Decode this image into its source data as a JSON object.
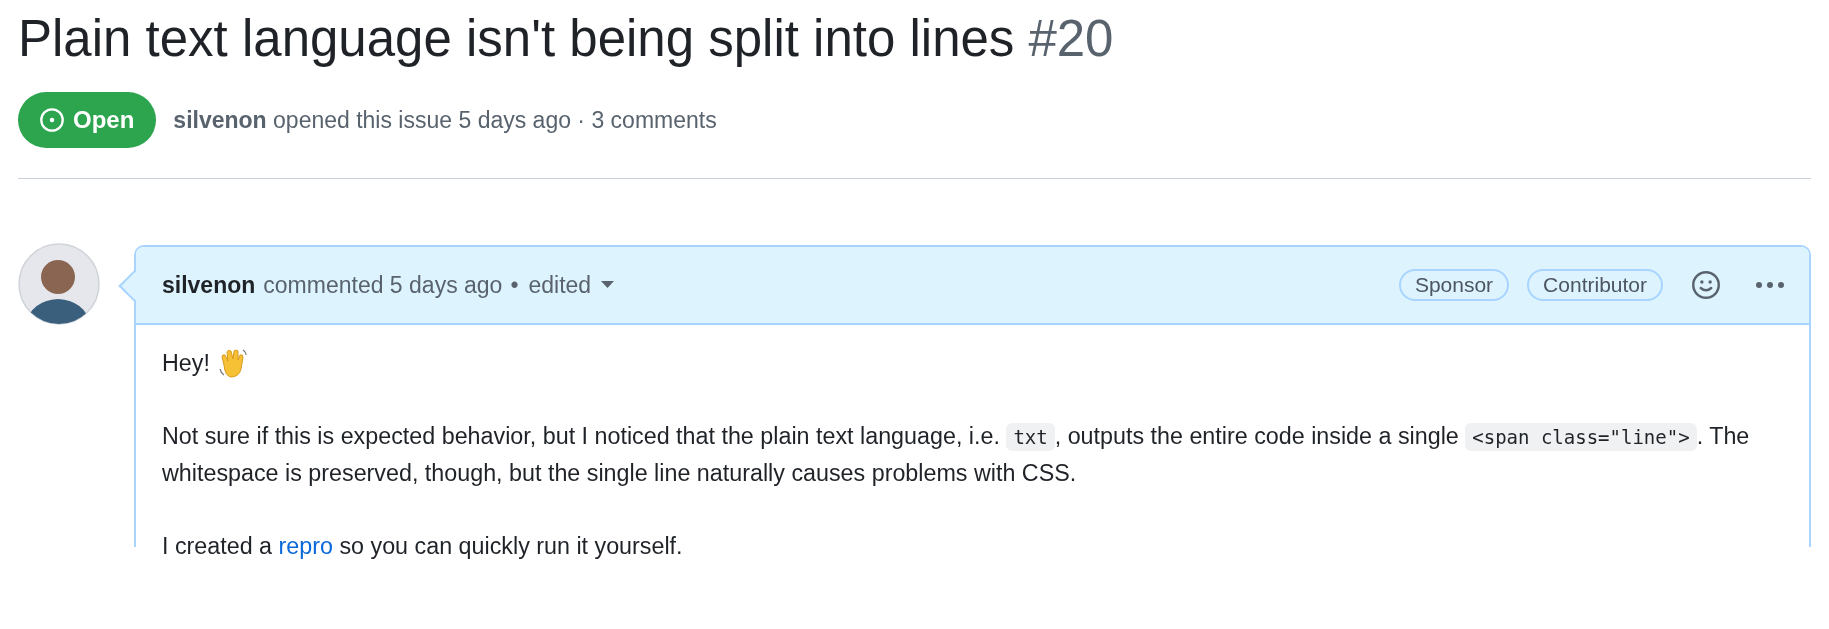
{
  "issue": {
    "title": "Plain text language isn't being split into lines",
    "number": "#20",
    "state": {
      "kind": "open",
      "label": "Open"
    },
    "meta": "**silvenon** opened this issue 5 days ago · 3 comments"
  },
  "comment": {
    "author": "silvenon",
    "action": "commented 5 days ago",
    "separator": "•",
    "edited": "edited",
    "badges": [
      "Sponsor",
      "Contributor"
    ],
    "body": [
      {
        "kind": "greeting",
        "text": "Hey!"
      },
      {
        "kind": "paragraph",
        "parts": [
          {
            "kind": "text",
            "text": "Not sure if this is expected behavior, but I noticed that the plain text language, i.e. "
          },
          {
            "kind": "code",
            "text": "txt"
          },
          {
            "kind": "text",
            "text": ", outputs the entire code inside a single "
          },
          {
            "kind": "code",
            "text": "<span class=\"line\">"
          },
          {
            "kind": "text",
            "text": ". The whitespace is preserved, though, but the single line naturally causes problems with CSS."
          }
        ]
      },
      {
        "kind": "paragraph",
        "parts": [
          {
            "kind": "text",
            "text": "I created a "
          },
          {
            "kind": "link",
            "text": "repro"
          },
          {
            "kind": "text",
            "text": " so you can quickly run it yourself."
          }
        ]
      }
    ]
  }
}
